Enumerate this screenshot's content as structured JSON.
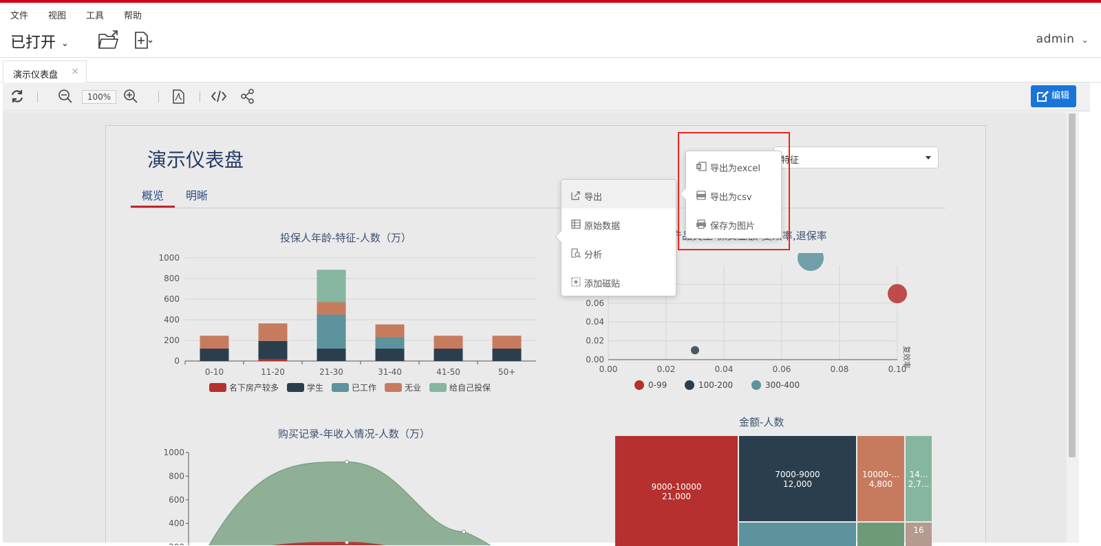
{
  "menu": {
    "items": [
      "文件",
      "视图",
      "工具",
      "帮助"
    ]
  },
  "toolbar": {
    "opened_label": "已打开",
    "user": "admin"
  },
  "tabs": [
    {
      "label": "演示仪表盘",
      "close": "×"
    }
  ],
  "viewer": {
    "zoom": "100%",
    "edit_label": "编辑"
  },
  "dashboard": {
    "title": "演示仪表盘",
    "tabs": [
      "概览",
      "明晰"
    ],
    "filter_value": "特征"
  },
  "context_menu": {
    "items": [
      "导出",
      "原始数据",
      "分析",
      "添加磁贴"
    ],
    "export_submenu": [
      "导出为excel",
      "导出为csv",
      "保存为图片"
    ]
  },
  "chart_data": [
    {
      "type": "bar",
      "title": "投保人年龄-特征-人数（万）",
      "categories": [
        "0-10",
        "11-20",
        "21-30",
        "31-40",
        "41-50",
        "50+"
      ],
      "stacked": true,
      "ylim": [
        0,
        1000
      ],
      "yticks": [
        0,
        200,
        400,
        600,
        800,
        1000
      ],
      "legend": "bottom",
      "series": [
        {
          "name": "名下房产较多",
          "color": "#b5302e",
          "values": [
            0,
            15,
            0,
            0,
            0,
            0
          ]
        },
        {
          "name": "学生",
          "color": "#2b3e4d",
          "values": [
            120,
            180,
            120,
            120,
            120,
            120
          ]
        },
        {
          "name": "已工作",
          "color": "#5c939d",
          "values": [
            0,
            0,
            330,
            110,
            0,
            0
          ]
        },
        {
          "name": "无业",
          "color": "#c77b5e",
          "values": [
            125,
            170,
            120,
            125,
            125,
            125
          ]
        },
        {
          "name": "给自己投保",
          "color": "#86b69f",
          "values": [
            0,
            0,
            315,
            0,
            0,
            0
          ]
        }
      ]
    },
    {
      "type": "scatter",
      "title": "产品类型-保费金额-复效率,退保率",
      "xlim": [
        0,
        0.1
      ],
      "ylim": [
        0,
        0.1
      ],
      "xticks": [
        "0.00",
        "0.02",
        "0.04",
        "0.06",
        "0.08",
        "0.10"
      ],
      "yticks": [
        "0.00",
        "0.02",
        "0.04",
        "0.06",
        "0.08"
      ],
      "ylabel": "复效率",
      "legend": "bottom",
      "series": [
        {
          "name": "0-99",
          "color": "#b5302e",
          "points": [
            {
              "x": 0.1,
              "y": 0.07,
              "size": 2
            }
          ]
        },
        {
          "name": "100-200",
          "color": "#2b3e4d",
          "points": [
            {
              "x": 0.03,
              "y": 0.01,
              "size": 1
            }
          ]
        },
        {
          "name": "300-400",
          "color": "#5c939d",
          "points": [
            {
              "x": 0.07,
              "y": 0.108,
              "size": 3
            }
          ]
        }
      ]
    },
    {
      "type": "area",
      "title": "购买记录-年收入情况-人数（万）",
      "ylim": [
        0,
        1000
      ],
      "yticks": [
        200,
        400,
        600,
        800,
        1000
      ],
      "series": [
        {
          "color": "#86aa8f",
          "points": [
            {
              "x": 0,
              "y": 0
            },
            {
              "x": 1,
              "y": 920
            },
            {
              "x": 2,
              "y": 330
            },
            {
              "x": 3,
              "y": 0
            }
          ]
        },
        {
          "color": "#b5302e",
          "points": [
            {
              "x": 0,
              "y": 0
            },
            {
              "x": 1,
              "y": 240
            },
            {
              "x": 2,
              "y": 80
            },
            {
              "x": 3,
              "y": 0
            }
          ]
        }
      ]
    },
    {
      "type": "treemap",
      "title": "金额-人数",
      "nodes": [
        {
          "label": "9000-10000",
          "value": "21,000",
          "color": "#b5302e"
        },
        {
          "label": "7000-9000",
          "value": "12,000",
          "color": "#2b3e4d"
        },
        {
          "label": "10000-...",
          "value": "4,800",
          "color": "#c77b5e"
        },
        {
          "label": "14...",
          "value": "2,7...",
          "color": "#86b69f"
        },
        {
          "label": "16",
          "value": "",
          "color": "#b59a8f"
        }
      ]
    }
  ]
}
